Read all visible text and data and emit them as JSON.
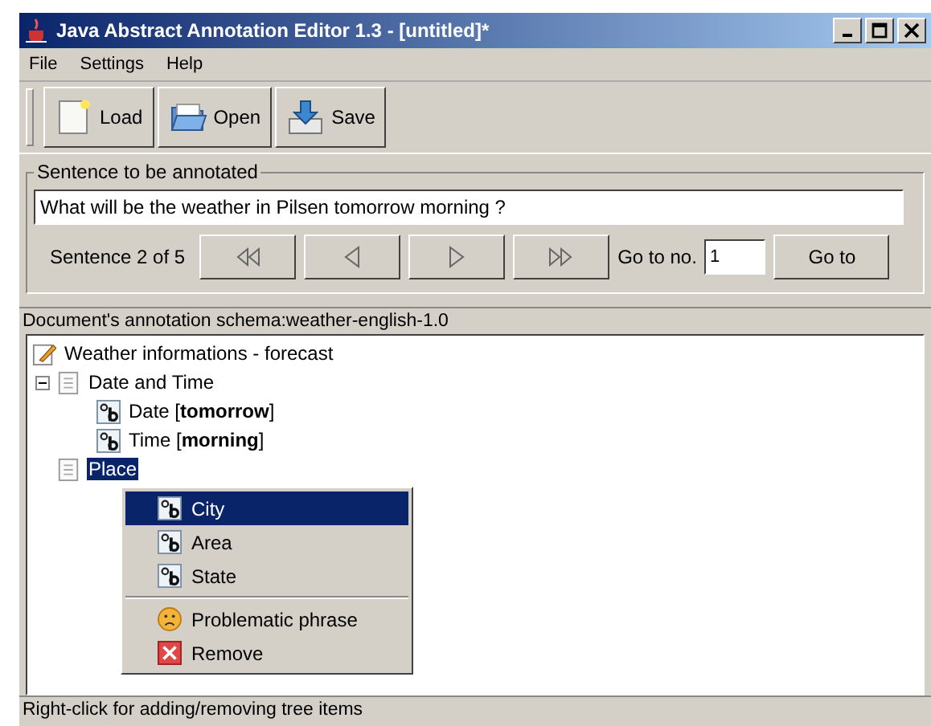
{
  "window": {
    "title": "Java Abstract Annotation Editor 1.3 - [untitled]*"
  },
  "menu_bar": [
    "File",
    "Settings",
    "Help"
  ],
  "toolbar": [
    {
      "label": "Load",
      "kind": "new"
    },
    {
      "label": "Open",
      "kind": "open"
    },
    {
      "label": "Save",
      "kind": "save"
    }
  ],
  "sentence_panel": {
    "legend": "Sentence to be annotated",
    "sentence": "What will be the weather in Pilsen tomorrow morning ?",
    "counter": "Sentence 2 of 5",
    "nav_buttons": [
      {
        "kind": "first"
      },
      {
        "kind": "prev"
      },
      {
        "kind": "next"
      },
      {
        "kind": "last"
      }
    ],
    "goto_label": "Go to no.",
    "goto_value": "1",
    "goto_button": "Go to"
  },
  "schema_label": "Document's annotation schema:weather-english-1.0",
  "tree": {
    "label": "Weather informations - forecast",
    "kind": "root",
    "selected": false,
    "children": [
      {
        "label": "Date and Time",
        "kind": "group",
        "selected": false,
        "expanded": true,
        "children": [
          {
            "label": "Date [**tomorrow**]",
            "kind": "slot",
            "selected": false
          },
          {
            "label": "Time [**morning**]",
            "kind": "slot",
            "selected": false
          }
        ]
      },
      {
        "label": "Place",
        "kind": "group",
        "selected": true
      }
    ]
  },
  "context_menu": [
    {
      "label": "City",
      "kind": "slot",
      "selected": true
    },
    {
      "label": "Area",
      "kind": "slot",
      "selected": false
    },
    {
      "label": "State",
      "kind": "slot",
      "selected": false
    },
    {
      "label": "Problematic phrase",
      "kind": "problem",
      "selected": false
    },
    {
      "label": "Remove",
      "kind": "remove",
      "selected": false
    }
  ],
  "status_bar": "Right-click for adding/removing tree items"
}
